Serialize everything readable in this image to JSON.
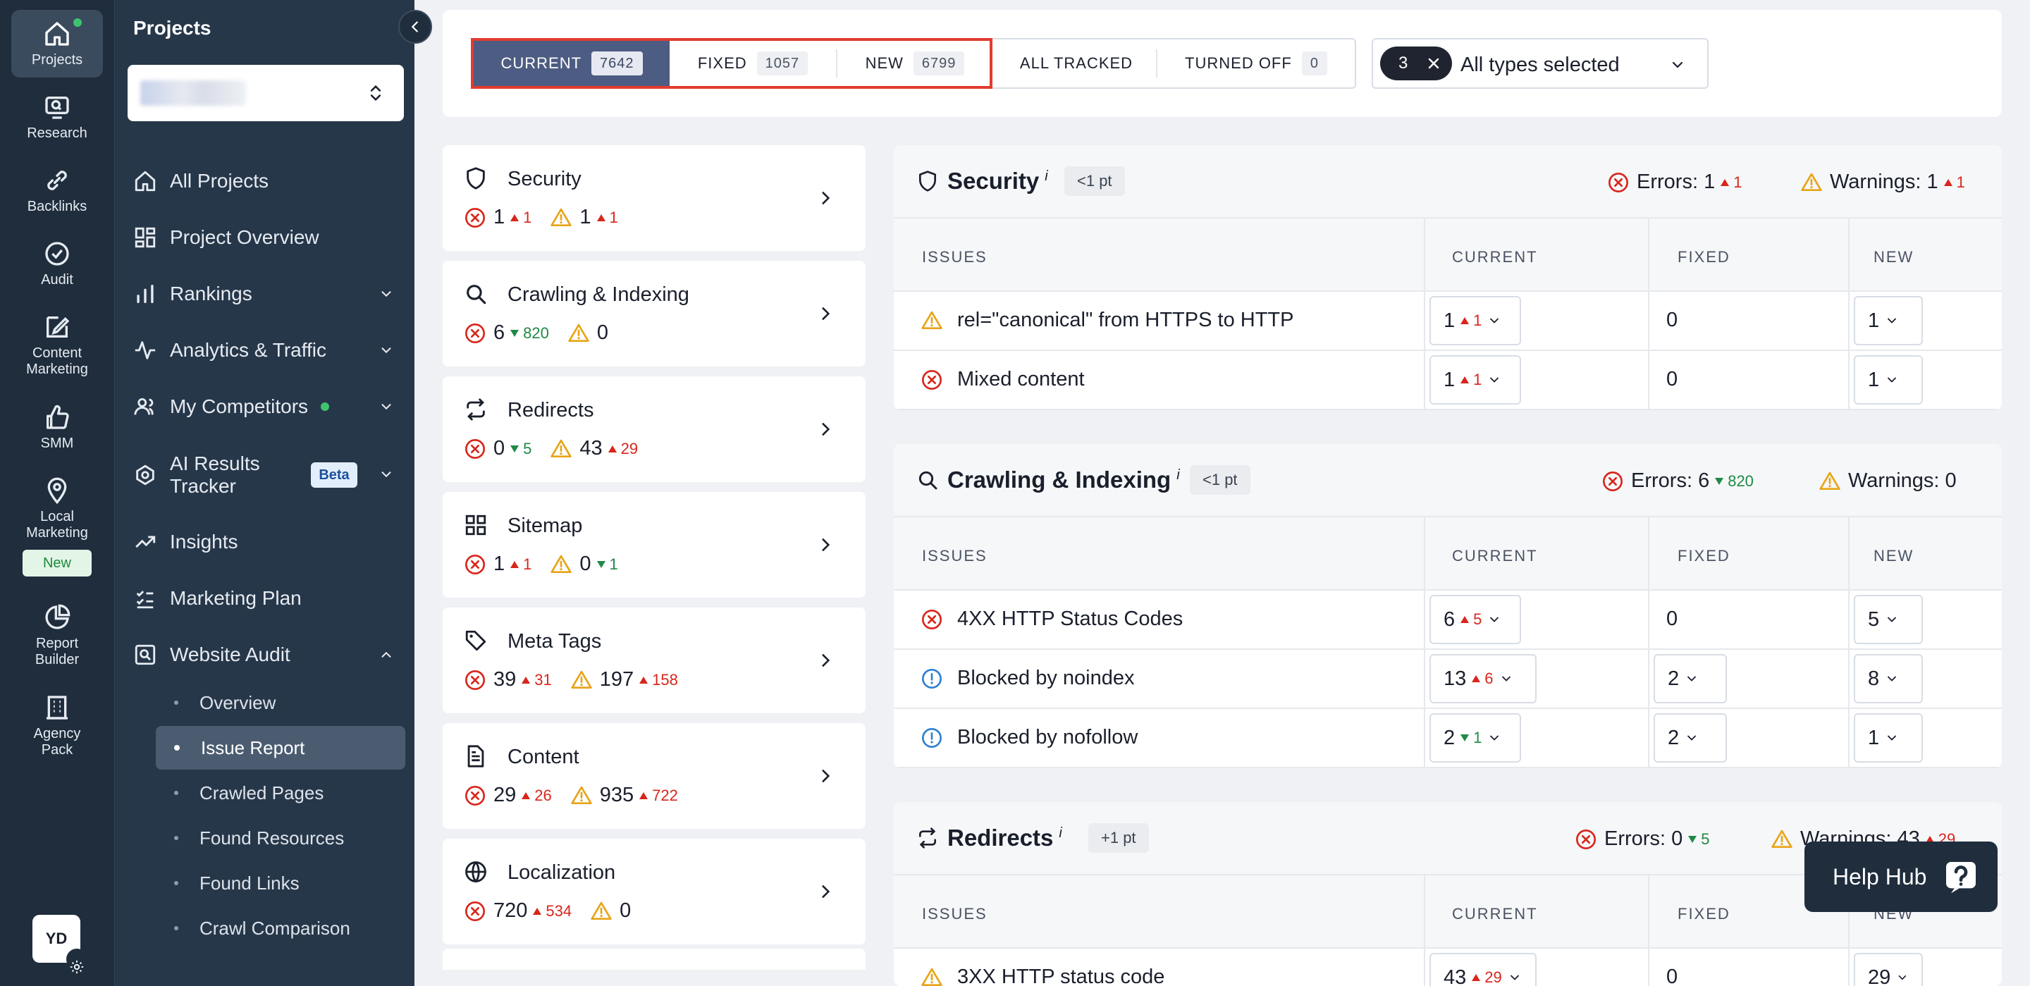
{
  "rail": {
    "items": [
      {
        "label": "Projects",
        "icon": "home-icon",
        "active": true
      },
      {
        "label": "Research",
        "icon": "monitor-search-icon"
      },
      {
        "label": "Backlinks",
        "icon": "link-icon"
      },
      {
        "label": "Audit",
        "icon": "check-circle-icon"
      },
      {
        "label": "Content Marketing",
        "icon": "edit-icon"
      },
      {
        "label": "SMM",
        "icon": "thumbs-up-icon"
      },
      {
        "label": "Local Marketing",
        "icon": "map-pin-icon"
      },
      {
        "label": "Report Builder",
        "icon": "pie-chart-icon"
      },
      {
        "label": "Agency Pack",
        "icon": "building-icon"
      }
    ],
    "new_badge": "New",
    "avatar_initials": "YD"
  },
  "sidebar": {
    "title": "Projects",
    "nav": [
      {
        "label": "All Projects",
        "icon": "home-icon"
      },
      {
        "label": "Project Overview",
        "icon": "dashboard-icon"
      },
      {
        "label": "Rankings",
        "icon": "bar-chart-icon"
      },
      {
        "label": "Analytics & Traffic",
        "icon": "pulse-icon"
      },
      {
        "label": "My Competitors",
        "icon": "users-icon"
      },
      {
        "label": "AI Results Tracker",
        "icon": "ai-icon"
      },
      {
        "label": "Insights",
        "icon": "trend-icon"
      },
      {
        "label": "Marketing Plan",
        "icon": "checklist-icon"
      },
      {
        "label": "Website Audit",
        "icon": "audit-icon"
      }
    ],
    "beta_badge": "Beta",
    "sub_items": [
      "Overview",
      "Issue Report",
      "Crawled Pages",
      "Found Resources",
      "Found Links",
      "Crawl Comparison"
    ]
  },
  "filters": {
    "tabs": [
      {
        "label": "CURRENT",
        "count": "7642"
      },
      {
        "label": "FIXED",
        "count": "1057"
      },
      {
        "label": "NEW",
        "count": "6799"
      },
      {
        "label": "ALL TRACKED",
        "count": ""
      },
      {
        "label": "TURNED OFF",
        "count": "0"
      }
    ],
    "types_count": "3",
    "types_label": "All types selected"
  },
  "categories": [
    {
      "name": "Security",
      "icon": "shield-icon",
      "errors": "1",
      "errors_delta": "1",
      "errors_dir": "up",
      "warnings": "1",
      "warnings_delta": "1",
      "warnings_dir": "up"
    },
    {
      "name": "Crawling & Indexing",
      "icon": "search-icon",
      "errors": "6",
      "errors_delta": "820",
      "errors_dir": "down",
      "warnings": "0",
      "warnings_delta": "",
      "warnings_dir": ""
    },
    {
      "name": "Redirects",
      "icon": "redirect-icon",
      "errors": "0",
      "errors_delta": "5",
      "errors_dir": "down",
      "warnings": "43",
      "warnings_delta": "29",
      "warnings_dir": "up"
    },
    {
      "name": "Sitemap",
      "icon": "grid-icon",
      "errors": "1",
      "errors_delta": "1",
      "errors_dir": "up",
      "warnings": "0",
      "warnings_delta": "1",
      "warnings_dir": "down"
    },
    {
      "name": "Meta Tags",
      "icon": "tag-icon",
      "errors": "39",
      "errors_delta": "31",
      "errors_dir": "up",
      "warnings": "197",
      "warnings_delta": "158",
      "warnings_dir": "up"
    },
    {
      "name": "Content",
      "icon": "document-icon",
      "errors": "29",
      "errors_delta": "26",
      "errors_dir": "up",
      "warnings": "935",
      "warnings_delta": "722",
      "warnings_dir": "up"
    },
    {
      "name": "Localization",
      "icon": "globe-icon",
      "errors": "720",
      "errors_delta": "534",
      "errors_dir": "up",
      "warnings": "0",
      "warnings_delta": "",
      "warnings_dir": ""
    }
  ],
  "table_headers": {
    "issues": "ISSUES",
    "current": "CURRENT",
    "fixed": "FIXED",
    "new": "NEW"
  },
  "panels": [
    {
      "title": "Security",
      "icon": "shield-icon",
      "info": "i",
      "points": "<1 pt",
      "errors_label": "Errors:",
      "errors": "1",
      "errors_delta": "1",
      "errors_dir": "up",
      "warnings_label": "Warnings:",
      "warnings": "1",
      "warnings_delta": "1",
      "warnings_dir": "up",
      "rows": [
        {
          "issue": "rel=\"canonical\" from HTTPS to HTTP",
          "type": "warning",
          "current": "1",
          "current_delta": "1",
          "current_dir": "up",
          "fixed": "0",
          "new": "1"
        },
        {
          "issue": "Mixed content",
          "type": "error",
          "current": "1",
          "current_delta": "1",
          "current_dir": "up",
          "fixed": "0",
          "new": "1"
        }
      ]
    },
    {
      "title": "Crawling & Indexing",
      "icon": "search-icon",
      "info": "i",
      "points": "<1 pt",
      "errors_label": "Errors:",
      "errors": "6",
      "errors_delta": "820",
      "errors_dir": "down",
      "warnings_label": "Warnings:",
      "warnings": "0",
      "warnings_delta": "",
      "warnings_dir": "",
      "rows": [
        {
          "issue": "4XX HTTP Status Codes",
          "type": "error",
          "current": "6",
          "current_delta": "5",
          "current_dir": "up",
          "fixed": "0",
          "new": "5"
        },
        {
          "issue": "Blocked by noindex",
          "type": "notice",
          "current": "13",
          "current_delta": "6",
          "current_dir": "up",
          "fixed": "2",
          "new": "8"
        },
        {
          "issue": "Blocked by nofollow",
          "type": "notice",
          "current": "2",
          "current_delta": "1",
          "current_dir": "down",
          "fixed": "2",
          "new": "1"
        }
      ]
    },
    {
      "title": "Redirects",
      "icon": "redirect-icon",
      "info": "i",
      "points": "+1 pt",
      "errors_label": "Errors:",
      "errors": "0",
      "errors_delta": "5",
      "errors_dir": "down",
      "warnings_label": "Warnings:",
      "warnings": "43",
      "warnings_delta": "29",
      "warnings_dir": "up",
      "rows": [
        {
          "issue": "3XX HTTP status code",
          "type": "warning",
          "current": "43",
          "current_delta": "29",
          "current_dir": "up",
          "fixed": "0",
          "new": "29"
        }
      ]
    }
  ],
  "help_hub": {
    "label": "Help Hub"
  },
  "colors": {
    "error": "#d8261c",
    "warning": "#e8a416",
    "notice": "#2f80d1",
    "positive": "#1f8a45",
    "rail": "#1f2d3d",
    "sidebar": "#27374a",
    "active_tab": "#4d5c82",
    "highlight": "#e33b30"
  }
}
